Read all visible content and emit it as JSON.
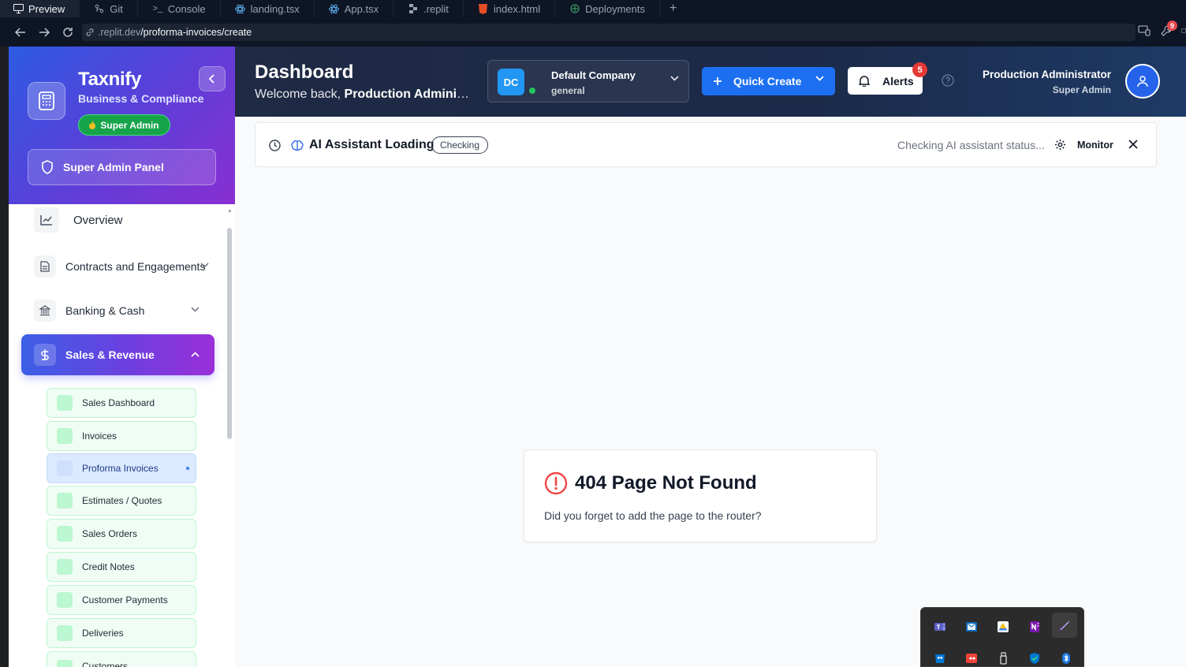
{
  "browser": {
    "tabs": [
      {
        "label": "Preview",
        "icon": "monitor-icon",
        "active": true
      },
      {
        "label": "Git",
        "icon": "git-icon"
      },
      {
        "label": "Console",
        "icon": "terminal-icon"
      },
      {
        "label": "landing.tsx",
        "icon": "react-icon"
      },
      {
        "label": "App.tsx",
        "icon": "react-icon"
      },
      {
        "label": ".replit",
        "icon": "replit-icon"
      },
      {
        "label": "index.html",
        "icon": "html-icon"
      },
      {
        "label": "Deployments",
        "icon": "deploy-icon"
      }
    ],
    "url_prefix": ".replit.dev",
    "url_path": "/proforma-invoices/create",
    "notification_count": "9"
  },
  "sidebar": {
    "brand_name": "Taxnify",
    "brand_sub": "Business & Compliance",
    "role_pill": "Super Admin",
    "panel_button": "Super Admin Panel",
    "items": [
      {
        "label": "Overview",
        "icon": "chart-line-icon"
      },
      {
        "label": "Contracts and Engagements",
        "icon": "document-icon"
      },
      {
        "label": "Banking & Cash",
        "icon": "bank-icon"
      },
      {
        "label": "Sales & Revenue",
        "icon": "dollar-icon"
      }
    ],
    "sub_items": [
      {
        "label": "Sales Dashboard"
      },
      {
        "label": "Invoices"
      },
      {
        "label": "Proforma Invoices",
        "active": true
      },
      {
        "label": "Estimates / Quotes"
      },
      {
        "label": "Sales Orders"
      },
      {
        "label": "Credit Notes"
      },
      {
        "label": "Customer Payments"
      },
      {
        "label": "Deliveries"
      },
      {
        "label": "Customers"
      }
    ]
  },
  "header": {
    "title": "Dashboard",
    "welcome_prefix": "Welcome back, ",
    "welcome_name": "Production Administrator",
    "company": {
      "initials": "DC",
      "name": "Default Company",
      "type": "general"
    },
    "quick_create": "Quick Create",
    "alerts": "Alerts",
    "alerts_count": "5",
    "user_name": "Production Administrator",
    "user_role": "Super Admin"
  },
  "ai_bar": {
    "title": "AI Assistant Loading",
    "status_pill": "Checking",
    "status_text": "Checking AI assistant status...",
    "monitor": "Monitor"
  },
  "not_found": {
    "title": "404 Page Not Found",
    "message": "Did you forget to add the page to the router?"
  },
  "tray": {
    "icons": [
      "teams-icon",
      "outlook-icon",
      "google-drive-icon",
      "onenote-icon",
      "pen-icon",
      "windows-store-icon",
      "anydesk-icon",
      "usb-icon",
      "defender-icon",
      "bluetooth-icon"
    ]
  },
  "colors": {
    "accent": "#1d6ff2",
    "sidebar_gradient_start": "#2d5be3",
    "sidebar_gradient_end": "#8a2fd1",
    "header_bg": "#1f2a44",
    "success": "#16a34a",
    "danger": "#ef4444"
  }
}
